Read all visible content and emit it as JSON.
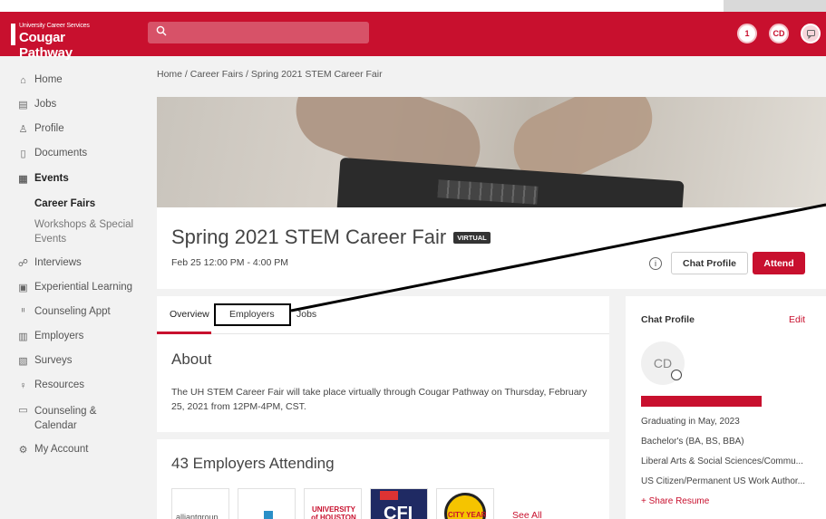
{
  "header": {
    "logo_small": "University Career Services",
    "logo_big": "Cougar Pathway",
    "search_icon": "search-icon",
    "notification_count": "1",
    "user_initials": "CD",
    "chat_icon": "chat-icon"
  },
  "sidebar": {
    "items": [
      {
        "label": "Home",
        "icon": "home-icon"
      },
      {
        "label": "Jobs",
        "icon": "briefcase-icon"
      },
      {
        "label": "Profile",
        "icon": "user-icon"
      },
      {
        "label": "Documents",
        "icon": "document-icon"
      },
      {
        "label": "Events",
        "icon": "calendar-icon"
      },
      {
        "label": "Interviews",
        "icon": "handshake-icon"
      },
      {
        "label": "Experiential Learning",
        "icon": "clipboard-icon"
      },
      {
        "label": "Counseling Appt",
        "icon": "people-icon"
      },
      {
        "label": "Employers",
        "icon": "building-icon"
      },
      {
        "label": "Surveys",
        "icon": "survey-icon"
      },
      {
        "label": "Resources",
        "icon": "bulb-icon"
      },
      {
        "label": "Counseling &",
        "label2": "Calendar",
        "icon": "calendar-icon"
      },
      {
        "label": "My Account",
        "icon": "gear-icon"
      }
    ],
    "sub_events": [
      {
        "label": "Career Fairs"
      },
      {
        "label": "Workshops & Special",
        "label2": "Events"
      }
    ]
  },
  "breadcrumb": "Home / Career Fairs / Spring 2021 STEM Career Fair",
  "event": {
    "title": "Spring 2021 STEM Career Fair",
    "badge": "VIRTUAL",
    "date": "Feb 25 12:00 PM - 4:00 PM",
    "chat_profile_button": "Chat Profile",
    "attend_button": "Attend"
  },
  "tabs": [
    {
      "label": "Overview"
    },
    {
      "label": "Employers"
    },
    {
      "label": "Jobs"
    }
  ],
  "about": {
    "heading": "About",
    "text": "The UH STEM Career Fair will take place virtually through Cougar Pathway on Thursday, February 25, 2021 from 12PM-4PM, CST."
  },
  "employers": {
    "heading": "43 Employers Attending",
    "logos": [
      "alliantgroup",
      "",
      "UNIVERSITY of HOUSTON",
      "CFI",
      "CITY YEAR"
    ],
    "see_all": "See All"
  },
  "chat_profile": {
    "heading": "Chat Profile",
    "edit": "Edit",
    "initials": "CD",
    "graduating": "Graduating in May, 2023",
    "degree": "Bachelor's (BA, BS, BBA)",
    "college": "Liberal Arts & Social Sciences/Commu...",
    "citizenship": "US Citizen/Permanent US Work Author...",
    "share_resume": "+ Share Resume"
  },
  "colors": {
    "brand_red": "#c8102e"
  }
}
